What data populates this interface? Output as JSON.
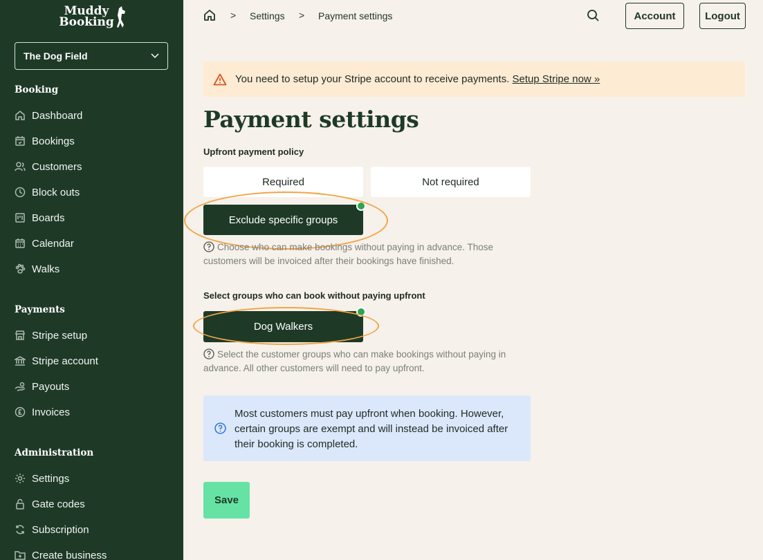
{
  "logo": {
    "line1": "Muddy",
    "line2": "Booking"
  },
  "venue": {
    "selected": "The Dog Field"
  },
  "sidebar": {
    "sections": [
      {
        "title": "Booking",
        "items": [
          "Dashboard",
          "Bookings",
          "Customers",
          "Block outs",
          "Boards",
          "Calendar",
          "Walks"
        ]
      },
      {
        "title": "Payments",
        "items": [
          "Stripe setup",
          "Stripe account",
          "Payouts",
          "Invoices"
        ]
      },
      {
        "title": "Administration",
        "items": [
          "Settings",
          "Gate codes",
          "Subscription",
          "Create business"
        ]
      }
    ]
  },
  "breadcrumb": {
    "items": [
      "Settings",
      "Payment settings"
    ]
  },
  "header": {
    "account_label": "Account",
    "logout_label": "Logout"
  },
  "alert": {
    "text": "You need to setup your Stripe account to receive payments.",
    "link": "Setup Stripe now »"
  },
  "page": {
    "title": "Payment settings"
  },
  "policy": {
    "label": "Upfront payment policy",
    "options": [
      "Required",
      "Not required",
      "Exclude specific groups"
    ],
    "selected": "Exclude specific groups",
    "help": "Choose who can make bookings without paying in advance. Those customers will be invoiced after their bookings have finished."
  },
  "groups": {
    "label": "Select groups who can book without paying upfront",
    "options": [
      "Dog Walkers"
    ],
    "selected": [
      "Dog Walkers"
    ],
    "help": "Select the customer groups who can make bookings without paying in advance. All other customers will need to pay upfront."
  },
  "info": {
    "text": "Most customers must pay upfront when booking. However, certain groups are exempt and will instead be invoiced after their booking is completed."
  },
  "save_label": "Save",
  "colors": {
    "sidebar": "#1e3a27",
    "background": "#f6f1ea",
    "save": "#66e3a4",
    "alert": "#fdebd3",
    "info": "#dbe8fb",
    "highlight_ring": "#f2a445",
    "check": "#2ca54f"
  }
}
